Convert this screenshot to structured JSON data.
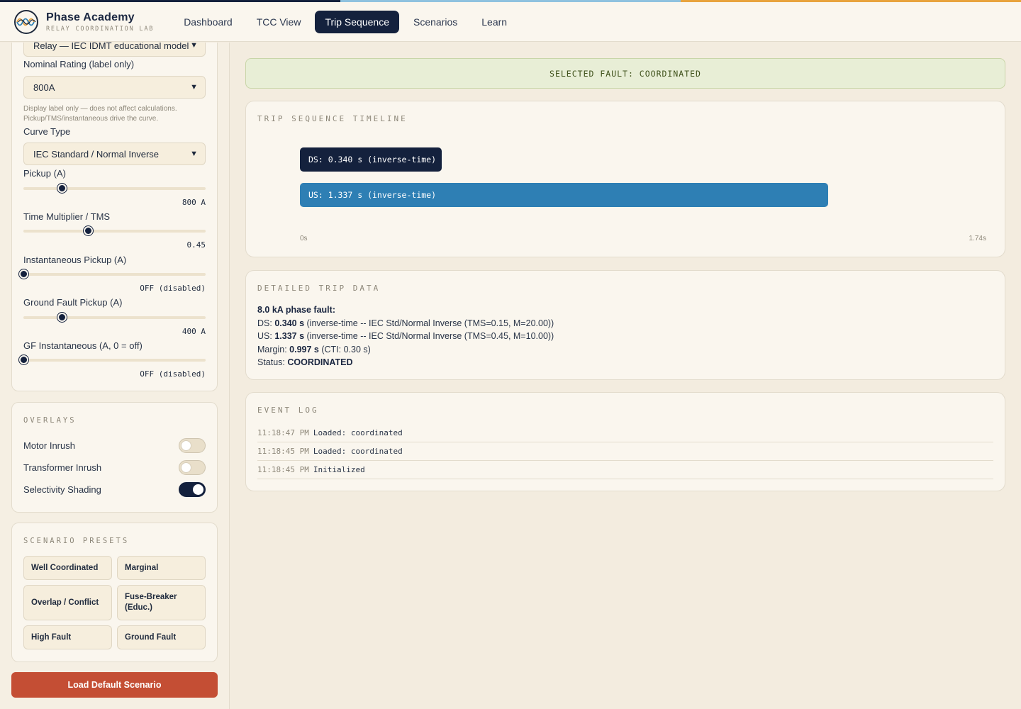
{
  "colors": {
    "stripe": [
      "#14213d",
      "#8fc2df",
      "#e8a33d"
    ],
    "ds_bar": "#14213d",
    "us_bar": "#2e7fb4",
    "load_button": "#c44e34",
    "banner_bg": "#e8eed6"
  },
  "header": {
    "app_name": "Phase Academy",
    "tagline": "RELAY COORDINATION LAB",
    "tabs": [
      {
        "label": "Dashboard",
        "active": false
      },
      {
        "label": "TCC View",
        "active": false
      },
      {
        "label": "Trip Sequence",
        "active": true
      },
      {
        "label": "Scenarios",
        "active": false
      },
      {
        "label": "Learn",
        "active": false
      }
    ]
  },
  "sidebar": {
    "device_model": {
      "value": "Relay — IEC IDMT educational model"
    },
    "nominal_rating": {
      "label": "Nominal Rating (label only)",
      "value": "800A",
      "hint": "Display label only — does not affect calculations. Pickup/TMS/instantaneous drive the curve."
    },
    "curve_type": {
      "label": "Curve Type",
      "value": "IEC Standard / Normal Inverse"
    },
    "pickup": {
      "label": "Pickup (A)",
      "value": "800 A",
      "fraction": 0.21
    },
    "tms": {
      "label": "Time Multiplier / TMS",
      "value": "0.45",
      "fraction": 0.356
    },
    "inst_pickup": {
      "label": "Instantaneous Pickup (A)",
      "value": "OFF (disabled)",
      "fraction": 0.0
    },
    "gf_pickup": {
      "label": "Ground Fault Pickup (A)",
      "value": "400 A",
      "fraction": 0.21
    },
    "gf_inst": {
      "label": "GF Instantaneous (A, 0 = off)",
      "value": "OFF (disabled)",
      "fraction": 0.0
    },
    "overlays": {
      "title": "OVERLAYS",
      "items": [
        {
          "label": "Motor Inrush",
          "on": false
        },
        {
          "label": "Transformer Inrush",
          "on": false
        },
        {
          "label": "Selectivity Shading",
          "on": true
        }
      ]
    },
    "presets": {
      "title": "SCENARIO PRESETS",
      "items": [
        "Well Coordinated",
        "Marginal",
        "Overlap / Conflict",
        "Fuse-Breaker (Educ.)",
        "High Fault",
        "Ground Fault"
      ]
    },
    "load_button": "Load Default Scenario"
  },
  "main": {
    "banner": "SELECTED FAULT: COORDINATED",
    "timeline": {
      "title": "TRIP SEQUENCE TIMELINE",
      "axis_start": "0s",
      "axis_end": "1.74s",
      "axis_max_s": 1.74,
      "bars": [
        {
          "label": "DS: 0.340 s (inverse-time)",
          "seconds": 0.34,
          "device": "DS"
        },
        {
          "label": "US: 1.337 s (inverse-time)",
          "seconds": 1.337,
          "device": "US"
        }
      ]
    },
    "trip_data": {
      "title": "DETAILED TRIP DATA",
      "heading": "8.0 kA phase fault:",
      "ds_prefix": "DS: ",
      "ds_value": "0.340 s",
      "ds_detail": " (inverse-time -- IEC Std/Normal Inverse (TMS=0.15, M=20.00))",
      "us_prefix": "US: ",
      "us_value": "1.337 s",
      "us_detail": " (inverse-time -- IEC Std/Normal Inverse (TMS=0.45, M=10.00))",
      "margin_prefix": "Margin: ",
      "margin_value": "0.997 s",
      "margin_detail": " (CTI: 0.30 s)",
      "status_prefix": "Status: ",
      "status_value": "COORDINATED"
    },
    "event_log": {
      "title": "EVENT LOG",
      "entries": [
        {
          "time": "11:18:47 PM",
          "message": "Loaded: coordinated"
        },
        {
          "time": "11:18:45 PM",
          "message": "Loaded: coordinated"
        },
        {
          "time": "11:18:45 PM",
          "message": "Initialized"
        }
      ]
    }
  }
}
